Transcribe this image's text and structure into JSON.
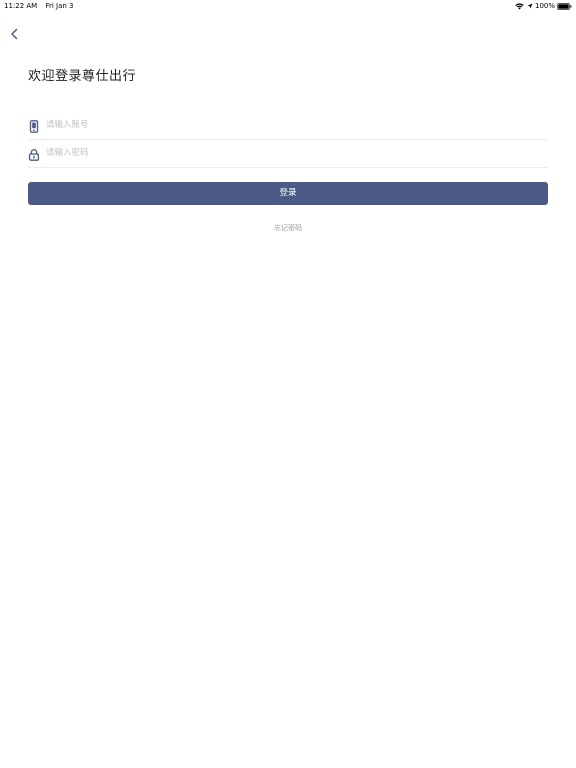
{
  "status_bar": {
    "time": "11:22 AM",
    "date": "Fri Jan 3",
    "battery": "100%",
    "icons": [
      "wifi-icon",
      "location-icon",
      "battery-icon"
    ]
  },
  "nav": {
    "back_icon": "chevron-left-icon"
  },
  "page": {
    "title": "欢迎登录尊仕出行"
  },
  "form": {
    "account": {
      "icon": "phone-icon",
      "placeholder": "请输入账号",
      "value": ""
    },
    "password": {
      "icon": "lock-icon",
      "placeholder": "请输入密码",
      "value": ""
    },
    "login_label": "登录",
    "forgot_label": "忘记密码"
  },
  "colors": {
    "primary_button": "#4a5a84",
    "accent_icon": "#4a5a84",
    "placeholder": "#c2c2c2",
    "divider": "#ececec",
    "link_text": "#9b9b9b"
  }
}
